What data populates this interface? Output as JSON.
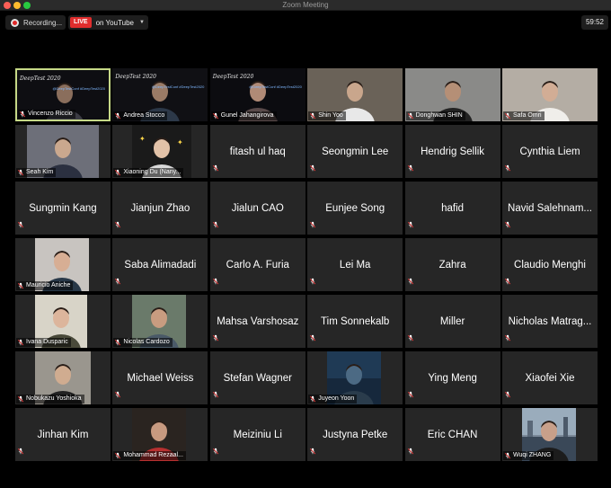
{
  "window": {
    "title": "Zoom Meeting"
  },
  "controls": {
    "recording_label": "Recording...",
    "live_badge": "LIVE",
    "live_target": "on YouTube",
    "timer": "59:52"
  },
  "branding": {
    "logo_text": "DeepTest 2020",
    "handle": "@DeepTestConf",
    "hashtag": "#DeepTest2020"
  },
  "colors": {
    "active_speaker_border": "#c6d987",
    "live_red": "#e02d2d",
    "tile_bg": "#262626",
    "muted_red": "#d63a3a"
  },
  "participants": [
    {
      "name": "Vincenzo Riccio",
      "video": true,
      "active": true
    },
    {
      "name": "Andrea Stocco",
      "video": true
    },
    {
      "name": "Gunel Jahangirova",
      "video": true
    },
    {
      "name": "Shin Yoo",
      "video": true
    },
    {
      "name": "Donghwan SHIN",
      "video": true
    },
    {
      "name": "Safa Omri",
      "video": true
    },
    {
      "name": "Seah Kim",
      "video": true
    },
    {
      "name": "Xiaoning Du (Nany...",
      "video": true
    },
    {
      "name": "fitash ul haq",
      "video": false
    },
    {
      "name": "Seongmin Lee",
      "video": false
    },
    {
      "name": "Hendrig Sellik",
      "video": false
    },
    {
      "name": "Cynthia Liem",
      "video": false
    },
    {
      "name": "Sungmin Kang",
      "video": false
    },
    {
      "name": "Jianjun Zhao",
      "video": false
    },
    {
      "name": "Jialun CAO",
      "video": false
    },
    {
      "name": "Eunjee Song",
      "video": false
    },
    {
      "name": "hafid",
      "video": false
    },
    {
      "name": "Navid Salehnam...",
      "video": false
    },
    {
      "name": "Mauricio Aniche",
      "video": true
    },
    {
      "name": "Saba Alimadadi",
      "video": false
    },
    {
      "name": "Carlo A. Furia",
      "video": false
    },
    {
      "name": "Lei Ma",
      "video": false
    },
    {
      "name": "Zahra",
      "video": false
    },
    {
      "name": "Claudio Menghi",
      "video": false
    },
    {
      "name": "Ivana Dusparic",
      "video": true
    },
    {
      "name": "Nicolas Cardozo",
      "video": true
    },
    {
      "name": "Mahsa Varshosaz",
      "video": false
    },
    {
      "name": "Tim Sonnekalb",
      "video": false
    },
    {
      "name": "Miller",
      "video": false
    },
    {
      "name": "Nicholas Matrag...",
      "video": false
    },
    {
      "name": "Nobukazu Yoshioka",
      "video": true
    },
    {
      "name": "Michael Weiss",
      "video": false
    },
    {
      "name": "Stefan Wagner",
      "video": false
    },
    {
      "name": "Juyeon Yoon",
      "video": true
    },
    {
      "name": "Ying Meng",
      "video": false
    },
    {
      "name": "Xiaofei Xie",
      "video": false
    },
    {
      "name": "Jinhan Kim",
      "video": false
    },
    {
      "name": "Mohammad Rezaal...",
      "video": true
    },
    {
      "name": "Meiziniu Li",
      "video": false
    },
    {
      "name": "Justyna Petke",
      "video": false
    },
    {
      "name": "Eric CHAN",
      "video": false
    },
    {
      "name": "Wuqi ZHANG",
      "video": true
    }
  ]
}
